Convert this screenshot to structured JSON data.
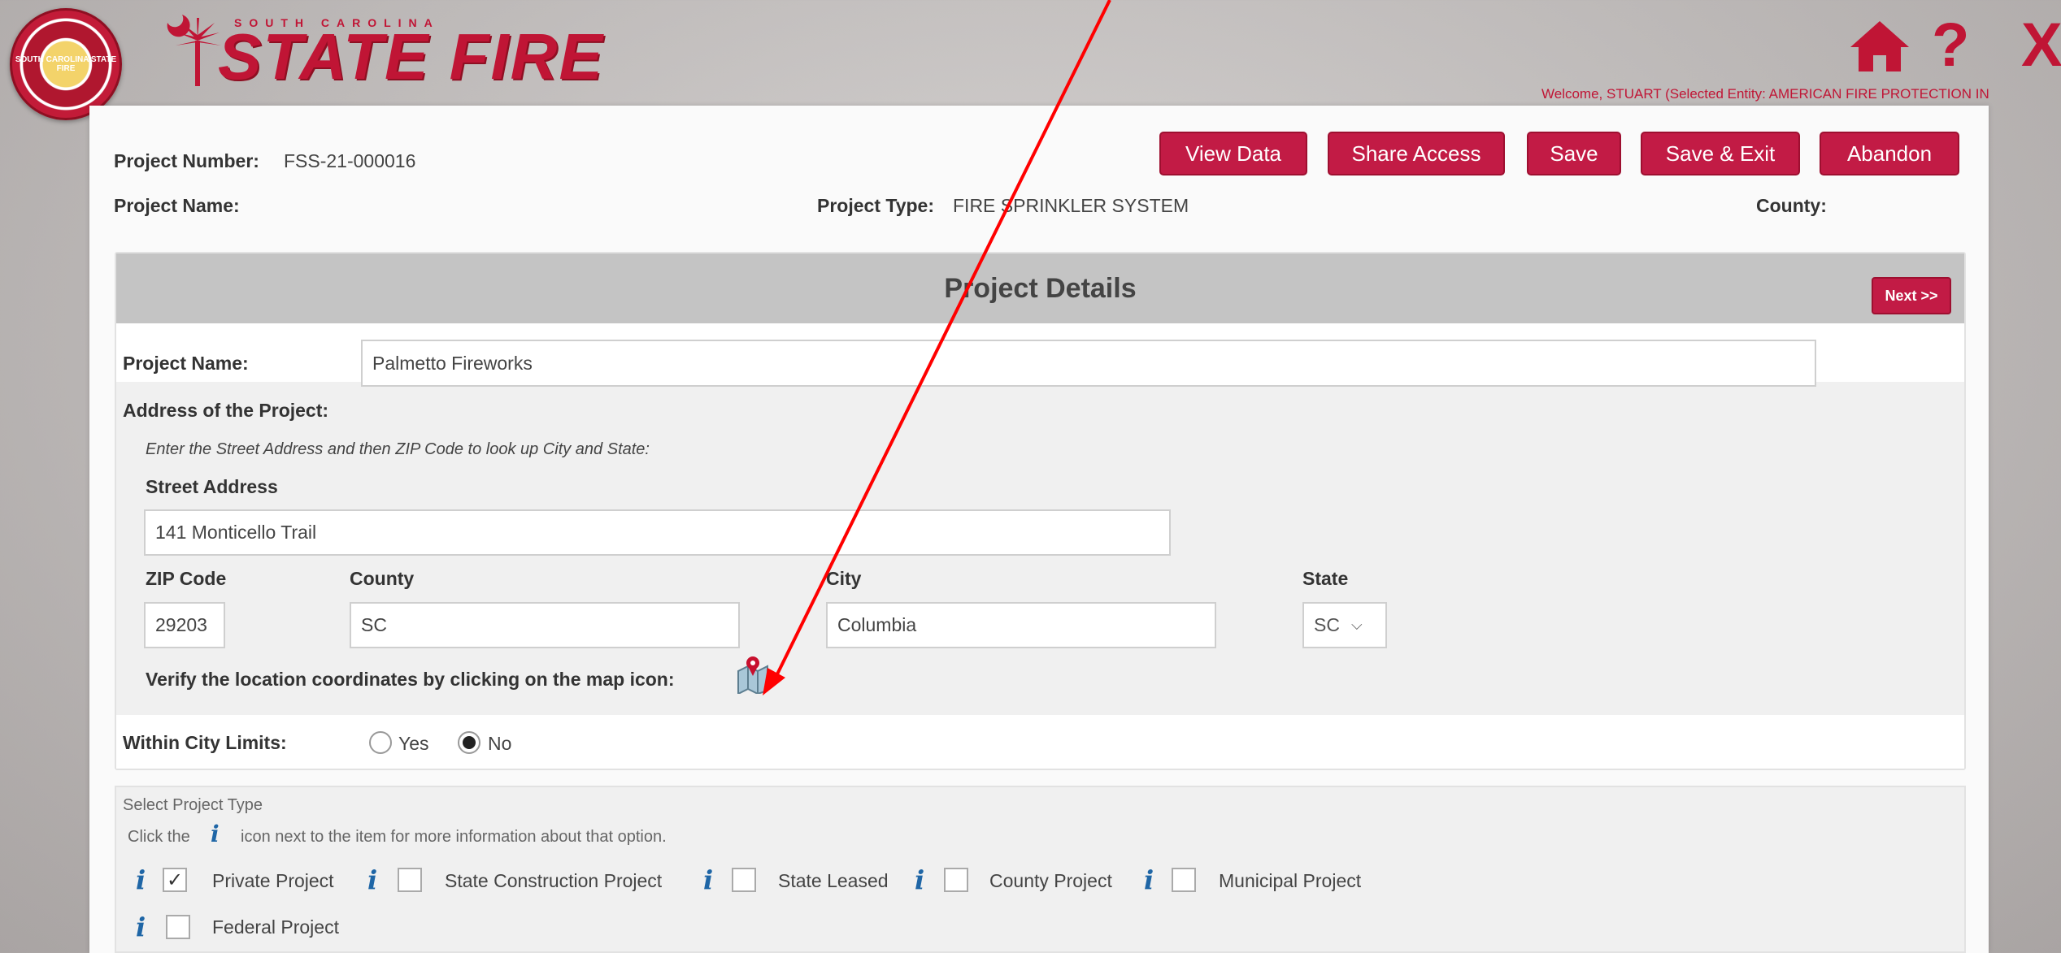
{
  "header": {
    "logo_small": "SOUTH CAROLINA",
    "logo_big": "STATE FIRE",
    "seal_text": "SOUTH CAROLINA STATE FIRE",
    "welcome": "Welcome, STUART (Selected Entity: AMERICAN FIRE PROTECTION IN",
    "home_icon": "home-icon",
    "help_icon": "help-icon",
    "close_icon": "close-icon",
    "close_glyph": "X",
    "help_glyph": "?"
  },
  "summary": {
    "project_number_label": "Project Number:",
    "project_number_value": "FSS-21-000016",
    "project_name_label": "Project Name:",
    "project_type_label": "Project Type:",
    "project_type_value": "FIRE SPRINKLER SYSTEM",
    "county_label": "County:"
  },
  "toolbar": {
    "view_data": "View Data",
    "share_access": "Share Access",
    "save": "Save",
    "save_exit": "Save & Exit",
    "abandon": "Abandon"
  },
  "details": {
    "title": "Project Details",
    "next": "Next >>",
    "project_name_label": "Project Name:",
    "project_name_value": "Palmetto Fireworks",
    "address_label": "Address of the Project:",
    "address_hint": "Enter the Street Address and then ZIP Code to look up City and State:",
    "street_label": "Street Address",
    "street_value": "141 Monticello Trail",
    "zip_label": "ZIP Code",
    "zip_value": "29203",
    "county_label": "County",
    "county_value": "SC",
    "city_label": "City",
    "city_value": "Columbia",
    "state_label": "State",
    "state_value": "SC",
    "verify_text": "Verify the location coordinates by clicking on the map icon:",
    "map_icon": "map-pin-icon",
    "city_limits_label": "Within City Limits:",
    "yes": "Yes",
    "no": "No",
    "city_limits_selected": "No"
  },
  "project_type": {
    "title": "Select Project Type",
    "hint_pre": "Click the",
    "hint_post": "icon next to the item for more information about that option.",
    "options": [
      {
        "label": "Private Project",
        "checked": true
      },
      {
        "label": "State Construction Project",
        "checked": false
      },
      {
        "label": "State Leased",
        "checked": false
      },
      {
        "label": "County Project",
        "checked": false
      },
      {
        "label": "Municipal Project",
        "checked": false
      },
      {
        "label": "Federal Project",
        "checked": false
      }
    ],
    "info_glyph": "i",
    "check_glyph": "✓"
  },
  "colors": {
    "accent": "#c21b45",
    "annotation": "#ff0000",
    "info": "#1f66a6"
  }
}
